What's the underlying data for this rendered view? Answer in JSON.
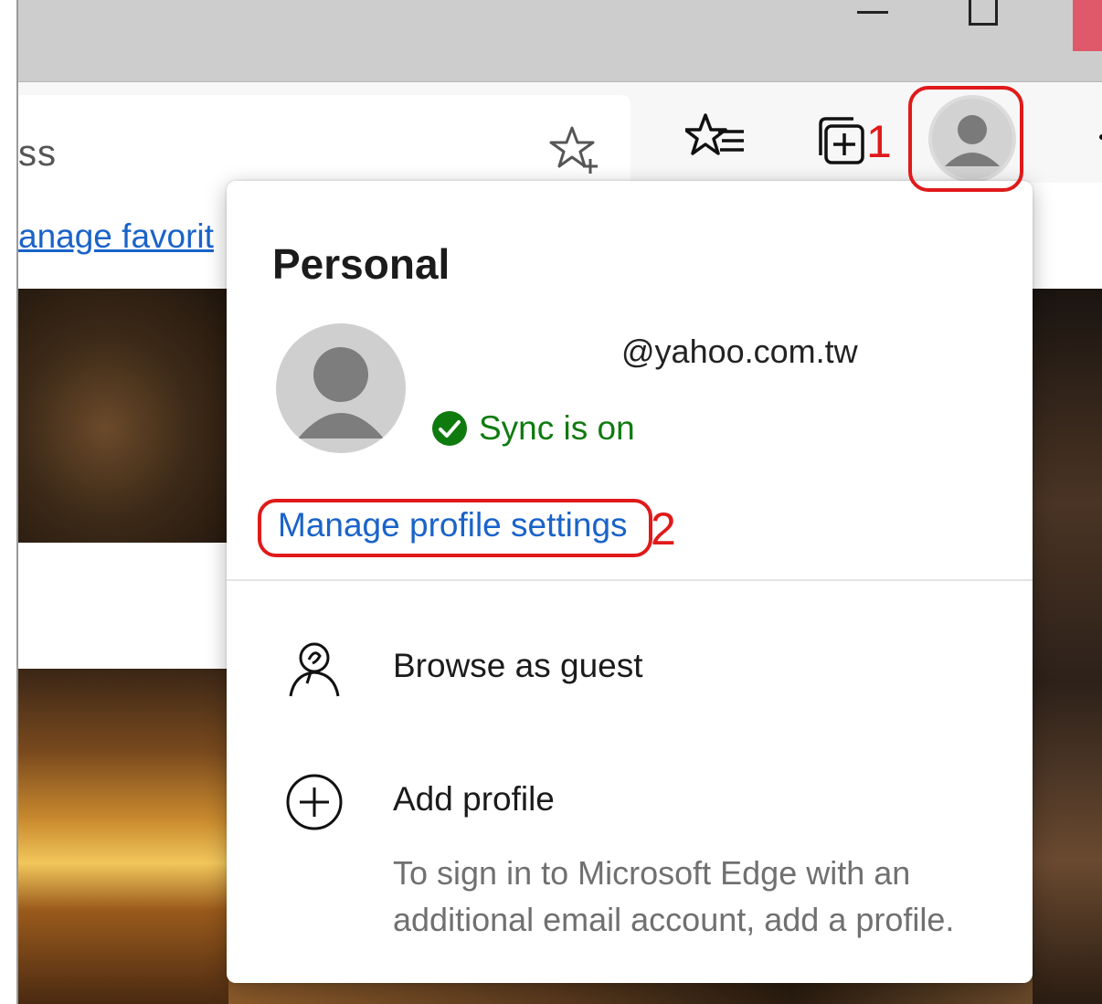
{
  "titlebar": {
    "minimize_icon": "minimize-icon",
    "maximize_icon": "maximize-icon",
    "close_color": "#e0596a"
  },
  "toolbar": {
    "address_text": "ss",
    "icons": [
      "add-favorite-icon",
      "favorites-icon",
      "collections-icon",
      "profile-avatar-icon",
      "more-icon"
    ]
  },
  "favorites_bar": {
    "manage_link": "anage favorit"
  },
  "flyout": {
    "title": "Personal",
    "email": "@yahoo.com.tw",
    "sync_text": "Sync is on",
    "sync_color": "#0f7b0f",
    "manage_profile": "Manage profile settings",
    "guest_label": "Browse as guest",
    "add_profile_label": "Add profile",
    "add_profile_desc": "To sign in to Microsoft Edge with an additional email account, add a profile."
  },
  "annotations": {
    "num1": "1",
    "num2": "2",
    "color": "#e01a1a"
  }
}
